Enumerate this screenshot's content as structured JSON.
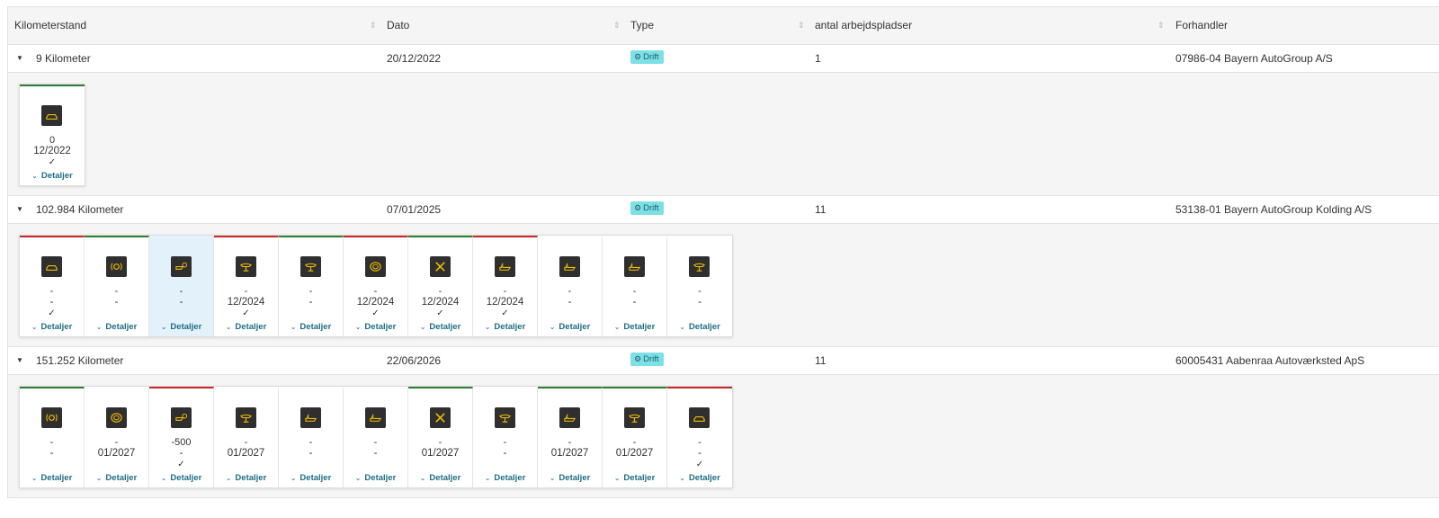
{
  "table": {
    "columns": [
      "Kilometerstand",
      "Dato",
      "Type",
      "antal arbejdspladser",
      "Forhandler"
    ],
    "rows": [
      {
        "km": "9 Kilometer",
        "date": "20/12/2022",
        "type": "Drift",
        "workplaces": "1",
        "dealer": "07986-04 Bayern AutoGroup A/S",
        "cards": [
          {
            "icon": "car-icon",
            "line1": "0",
            "line2": "12/2022",
            "check": "✓",
            "detail": "Detaljer",
            "border": "green"
          }
        ]
      },
      {
        "km": "102.984 Kilometer",
        "date": "07/01/2025",
        "type": "Drift",
        "workplaces": "11",
        "dealer": "53138-01 Bayern AutoGroup Kolding A/S",
        "cards": [
          {
            "icon": "car-icon",
            "line1": "-",
            "line2": "-",
            "check": "✓",
            "detail": "Detaljer",
            "border": "red"
          },
          {
            "icon": "brake-icon",
            "line1": "-",
            "line2": "-",
            "check": "",
            "detail": "Detaljer",
            "border": "green"
          },
          {
            "icon": "oil-brake-icon",
            "line1": "-",
            "line2": "-",
            "check": "",
            "detail": "Detaljer",
            "border": "none",
            "selected": true
          },
          {
            "icon": "lift-icon",
            "line1": "-",
            "line2": "12/2024",
            "check": "✓",
            "detail": "Detaljer",
            "border": "red"
          },
          {
            "icon": "lift-icon",
            "line1": "-",
            "line2": "-",
            "check": "",
            "detail": "Detaljer",
            "border": "green"
          },
          {
            "icon": "tire-icon",
            "line1": "-",
            "line2": "12/2024",
            "check": "✓",
            "detail": "Detaljer",
            "border": "red"
          },
          {
            "icon": "tools-icon",
            "line1": "-",
            "line2": "12/2024",
            "check": "✓",
            "detail": "Detaljer",
            "border": "green"
          },
          {
            "icon": "oil-can-icon",
            "line1": "-",
            "line2": "12/2024",
            "check": "✓",
            "detail": "Detaljer",
            "border": "red"
          },
          {
            "icon": "oil-can-icon",
            "line1": "-",
            "line2": "-",
            "check": "",
            "detail": "Detaljer",
            "border": "none"
          },
          {
            "icon": "oil-can-icon",
            "line1": "-",
            "line2": "-",
            "check": "",
            "detail": "Detaljer",
            "border": "none"
          },
          {
            "icon": "lift-icon",
            "line1": "-",
            "line2": "-",
            "check": "",
            "detail": "Detaljer",
            "border": "none"
          }
        ]
      },
      {
        "km": "151.252 Kilometer",
        "date": "22/06/2026",
        "type": "Drift",
        "workplaces": "11",
        "dealer": "60005431 Aabenraa Autoværksted ApS",
        "cards": [
          {
            "icon": "brake-icon",
            "line1": "-",
            "line2": "-",
            "check": "",
            "detail": "Detaljer",
            "border": "green"
          },
          {
            "icon": "tire-icon",
            "line1": "-",
            "line2": "01/2027",
            "check": "",
            "detail": "Detaljer",
            "border": "none"
          },
          {
            "icon": "oil-brake-icon",
            "line1": "-500",
            "line2": "-",
            "check": "✓",
            "detail": "Detaljer",
            "border": "red"
          },
          {
            "icon": "lift-icon",
            "line1": "-",
            "line2": "01/2027",
            "check": "",
            "detail": "Detaljer",
            "border": "none"
          },
          {
            "icon": "oil-can-icon",
            "line1": "-",
            "line2": "-",
            "check": "",
            "detail": "Detaljer",
            "border": "none"
          },
          {
            "icon": "oil-can-icon",
            "line1": "-",
            "line2": "-",
            "check": "",
            "detail": "Detaljer",
            "border": "none"
          },
          {
            "icon": "tools-icon",
            "line1": "-",
            "line2": "01/2027",
            "check": "",
            "detail": "Detaljer",
            "border": "green"
          },
          {
            "icon": "lift-icon",
            "line1": "-",
            "line2": "-",
            "check": "",
            "detail": "Detaljer",
            "border": "none"
          },
          {
            "icon": "oil-can-icon",
            "line1": "-",
            "line2": "01/2027",
            "check": "",
            "detail": "Detaljer",
            "border": "green"
          },
          {
            "icon": "lift-icon",
            "line1": "-",
            "line2": "01/2027",
            "check": "",
            "detail": "Detaljer",
            "border": "green"
          },
          {
            "icon": "car-icon",
            "line1": "-",
            "line2": "-",
            "check": "✓",
            "detail": "Detaljer",
            "border": "red"
          }
        ]
      }
    ]
  },
  "colors": {
    "badge": "#7de0e6",
    "green": "#2e7d32",
    "red": "#c62828",
    "icon_bg": "#2f2f2f",
    "icon_fg": "#f5c000",
    "link": "#1e6d83"
  }
}
